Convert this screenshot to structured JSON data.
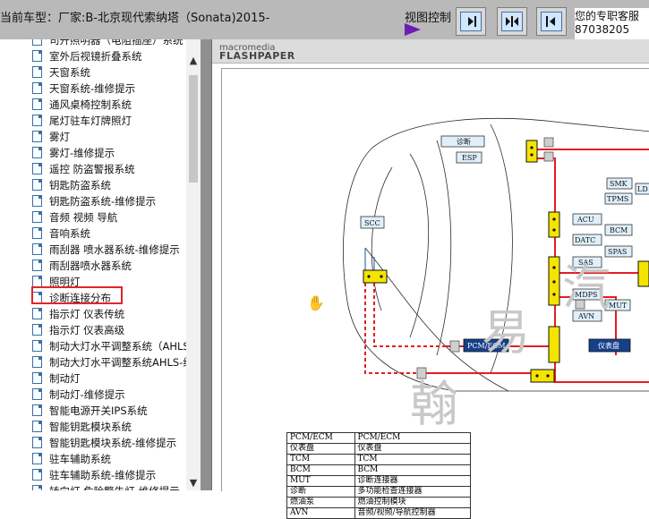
{
  "header": {
    "title": "当前车型：厂家:B-北京现代索纳塔（Sonata)2015-",
    "view_control_label": "视图控制",
    "service_line1": "您的专职客服",
    "service_line2": "87038205"
  },
  "sidebar": {
    "items": [
      "司开照明器（电阻插座）系统",
      "室外后视镜折叠系统",
      "天窗系统",
      "天窗系统-维修提示",
      "通风桌椅控制系统",
      "尾灯驻车灯牌照灯",
      "雾灯",
      "雾灯-维修提示",
      "遥控 防盗警报系统",
      "钥匙防盗系统",
      "钥匙防盗系统-维修提示",
      "音频 视频 导航",
      "音响系统",
      "雨刮器 喷水器系统-维修提示",
      "雨刮器喷水器系统",
      "照明灯",
      "诊断连接分布",
      "指示灯 仪表传统",
      "指示灯 仪表高级",
      "制动大灯水平调整系统（AHLS",
      "制动大灯水平调整系统AHLS-维",
      "制动灯",
      "制动灯-维修提示",
      "智能电源开关IPS系统",
      "智能钥匙模块系统",
      "智能钥匙模块系统-维修提示",
      "驻车辅助系统",
      "驻车辅助系统-维修提示",
      "转向灯 危险警告灯-维修提示"
    ],
    "selected_index": 16
  },
  "viewer": {
    "logo_top": "macromedia",
    "logo_bottom": "FLASHPAPER"
  },
  "diagram": {
    "boxes": [
      "诊断",
      "ESP",
      "SCC",
      "SMK",
      "TPMS",
      "LD",
      "ACU",
      "BCM",
      "DATC",
      "SPAS",
      "SAS",
      "MDPS",
      "MUT",
      "AVN",
      "PCM/ECM",
      "仪表盘"
    ]
  },
  "legend": {
    "rows": [
      [
        "PCM/ECM",
        "PCM/ECM"
      ],
      [
        "仪表盘",
        "仪表盘"
      ],
      [
        "TCM",
        "TCM"
      ],
      [
        "BCM",
        "BCM"
      ],
      [
        "MUT",
        "诊断连接器"
      ],
      [
        "诊断",
        "多功能检查连接器"
      ],
      [
        "燃油泵",
        "燃油控制模块"
      ],
      [
        "AVN",
        "音频/视频/导航控制器"
      ]
    ]
  },
  "watermark": "翰易汽",
  "colors": {
    "topbar": "#b9b9b9",
    "wire_red": "#e31e24",
    "connector_yellow": "#f4e400",
    "module_dark": "#17408b",
    "selection_red": "#e0262b",
    "module_light": "#dff0fb"
  }
}
